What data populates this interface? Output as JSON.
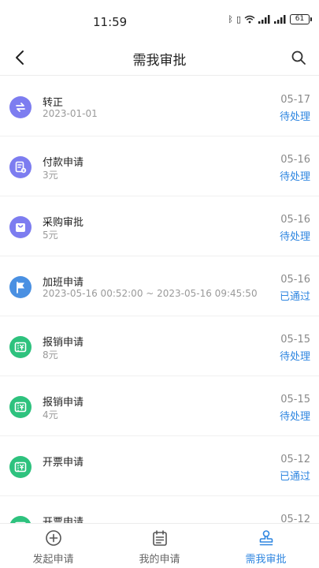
{
  "status_bar": {
    "time": "11:59",
    "battery": "61"
  },
  "header": {
    "title": "需我审批"
  },
  "colors": {
    "accent": "#2f86e0",
    "purple": "#7d7df0",
    "blue": "#4a90e2",
    "green": "#2ec27e"
  },
  "items": [
    {
      "title": "转正",
      "subtitle": "2023-01-01",
      "date": "05-17",
      "status": "待处理",
      "icon": "swap-icon",
      "icon_color": "#7d7df0"
    },
    {
      "title": "付款申请",
      "subtitle": "3元",
      "date": "05-16",
      "status": "待处理",
      "icon": "payment-doc-icon",
      "icon_color": "#7d7df0"
    },
    {
      "title": "采购审批",
      "subtitle": "5元",
      "date": "05-16",
      "status": "待处理",
      "icon": "shopping-bag-icon",
      "icon_color": "#7d7df0"
    },
    {
      "title": "加班申请",
      "subtitle": "2023-05-16 00:52:00 ~ 2023-05-16 09:45:50",
      "date": "05-16",
      "status": "已通过",
      "icon": "flag-icon",
      "icon_color": "#4a90e2"
    },
    {
      "title": "报销申请",
      "subtitle": "8元",
      "date": "05-15",
      "status": "待处理",
      "icon": "receipt-icon",
      "icon_color": "#2ec27e"
    },
    {
      "title": "报销申请",
      "subtitle": "4元",
      "date": "05-15",
      "status": "待处理",
      "icon": "receipt-icon",
      "icon_color": "#2ec27e"
    },
    {
      "title": "开票申请",
      "subtitle": "",
      "date": "05-12",
      "status": "已通过",
      "icon": "receipt-icon",
      "icon_color": "#2ec27e"
    },
    {
      "title": "开票申请",
      "subtitle": "",
      "date": "05-12",
      "status": "",
      "icon": "receipt-icon",
      "icon_color": "#2ec27e"
    }
  ],
  "tabs": [
    {
      "label": "发起申请",
      "icon": "plus-circle-icon",
      "active": false
    },
    {
      "label": "我的申请",
      "icon": "calendar-list-icon",
      "active": false
    },
    {
      "label": "需我审批",
      "icon": "stamp-icon",
      "active": true
    }
  ]
}
